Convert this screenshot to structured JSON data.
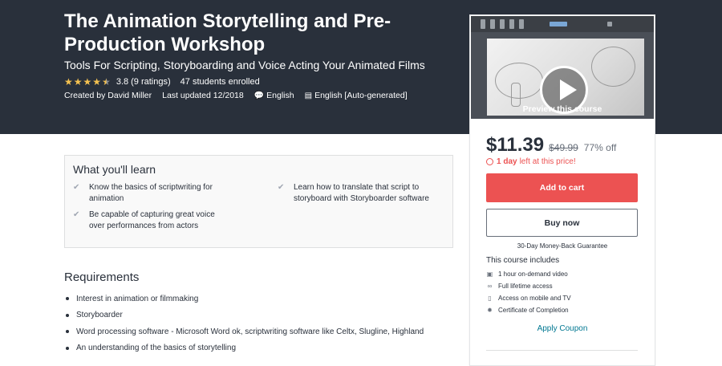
{
  "course": {
    "title": "The Animation Storytelling and Pre-Production Workshop",
    "subtitle": "Tools For Scripting, Storyboarding and Voice Acting Your Animated Films",
    "rating_value": "3.8",
    "rating_count": "(9 ratings)",
    "stars_filled": 3.8,
    "enrolled": "47 students enrolled",
    "created_by": "Created by David Miller",
    "last_updated": "Last updated 12/2018",
    "language": "English",
    "captions": "English [Auto-generated]"
  },
  "sidebar": {
    "preview_label": "Preview this course",
    "price": "$11.39",
    "old_price": "$49.99",
    "discount": "77% off",
    "timer_bold": "1 day",
    "timer_rest": "left at this price!",
    "add_to_cart": "Add to cart",
    "buy_now": "Buy now",
    "guarantee": "30-Day Money-Back Guarantee",
    "includes_title": "This course includes",
    "includes": [
      {
        "icon": "video-icon",
        "label": "1 hour on-demand video"
      },
      {
        "icon": "infinity-icon",
        "label": "Full lifetime access"
      },
      {
        "icon": "mobile-icon",
        "label": "Access on mobile and TV"
      },
      {
        "icon": "certificate-icon",
        "label": "Certificate of Completion"
      }
    ],
    "apply_coupon": "Apply Coupon"
  },
  "learn": {
    "title": "What you'll learn",
    "items": [
      "Know the basics of scriptwriting for animation",
      "Learn how to translate that script to storyboard with Storyboarder software",
      "Be capable of capturing great voice over performances from actors"
    ]
  },
  "requirements": {
    "title": "Requirements",
    "items": [
      "Interest in animation or filmmaking",
      "Storyboarder",
      "Word processing software - Microsoft Word ok, scriptwriting software like Celtx, Slugline, Highland",
      "An understanding of the basics of storytelling"
    ]
  },
  "colors": {
    "hero_bg": "#29303b",
    "accent_red": "#ec5252",
    "star": "#f4c150",
    "link": "#007791"
  }
}
